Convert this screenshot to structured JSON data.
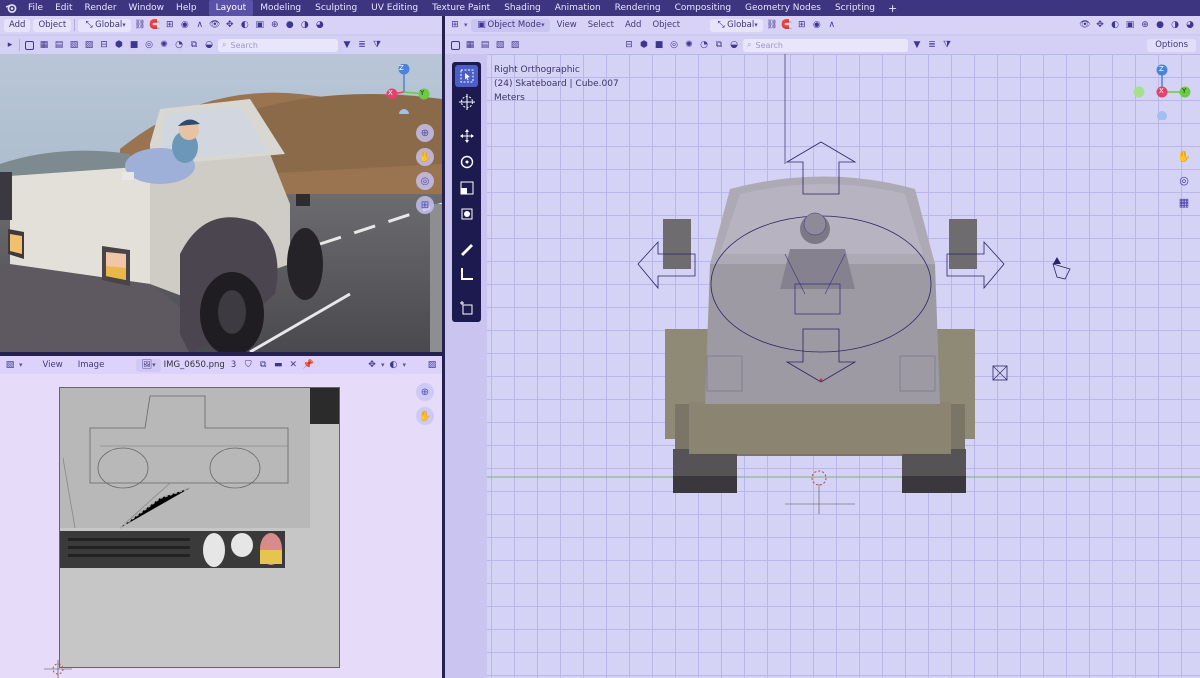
{
  "topbar": {
    "menus": [
      "File",
      "Edit",
      "Render",
      "Window",
      "Help"
    ],
    "workspaces": [
      "Layout",
      "Modeling",
      "Sculpting",
      "UV Editing",
      "Texture Paint",
      "Shading",
      "Animation",
      "Rendering",
      "Compositing",
      "Geometry Nodes",
      "Scripting"
    ],
    "active_workspace": "Layout",
    "add_tab": "+"
  },
  "left_viewport": {
    "menu_add": "Add",
    "menu_object": "Object",
    "orientation": "Global",
    "search_placeholder": "Search",
    "axes": {
      "z": "Z",
      "x": "X",
      "y": "Y"
    }
  },
  "image_editor": {
    "menu_view": "View",
    "menu_image": "Image",
    "image_name": "IMG_0650.png",
    "users_count": "3"
  },
  "right_viewport": {
    "mode": "Object Mode",
    "menu_view": "View",
    "menu_select": "Select",
    "menu_add": "Add",
    "menu_object": "Object",
    "orientation": "Global",
    "search_placeholder": "Search",
    "options_label": "Options",
    "view_name": "Right Orthographic",
    "object_info": "(24) Skateboard | Cube.007",
    "units": "Meters",
    "axes": {
      "z": "Z",
      "x": "X",
      "y": "Y"
    }
  },
  "colors": {
    "topbar": "#3d3580",
    "header": "#d8d3f6",
    "toolbar": "#1c1a4e",
    "active_tool": "#4a5fc8",
    "axis_x": "#e0436b",
    "axis_y": "#6ccb45",
    "axis_z": "#4a84d8"
  }
}
